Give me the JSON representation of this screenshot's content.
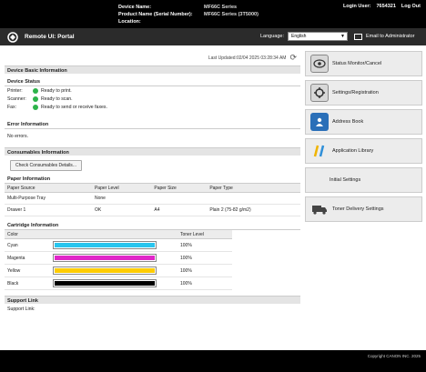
{
  "topbar": {
    "device_name_label": "Device Name:",
    "device_name_value": "MF66C Series",
    "product_name_label": "Product Name (Serial Number):",
    "product_name_value": "MF66C Series (3T5000)",
    "location_label": "Location:",
    "login_user_label": "Login User:",
    "login_user_value": "7654321",
    "logout_label": "Log Out"
  },
  "header": {
    "portal_title": "Remote UI: Portal",
    "language_label": "Language:",
    "language_value": "English",
    "email_admin_label": "Email to Administrator"
  },
  "main": {
    "last_updated": "Last Updated:02/04 2025 03:28:34 AM",
    "device_basic_title": "Device Basic Information",
    "device_status_title": "Device Status",
    "status_rows": [
      {
        "key": "Printer:",
        "value": "Ready to print."
      },
      {
        "key": "Scanner:",
        "value": "Ready to scan."
      },
      {
        "key": "Fax:",
        "value": "Ready to send or receive faxes."
      }
    ],
    "error_title": "Error Information",
    "error_text": "No errors.",
    "consumables_title": "Consumables Information",
    "check_consumables_label": "Check Consumables Details...",
    "paper_title": "Paper Information",
    "paper_headers": [
      "Paper Source",
      "Paper Level",
      "Paper Size",
      "Paper Type"
    ],
    "paper_rows": [
      [
        "Multi-Purpose Tray",
        "None",
        "",
        ""
      ],
      [
        "Drawer 1",
        "OK",
        "A4",
        "Plain 2 (75-82 g/m2)"
      ]
    ],
    "cartridge_title": "Cartridge Information",
    "cartridge_headers": [
      "Color",
      "",
      "Toner Level"
    ],
    "cartridges": [
      {
        "name": "Cyan",
        "level": "100%",
        "color": "#29c5ee"
      },
      {
        "name": "Magenta",
        "level": "100%",
        "color": "#e026c8"
      },
      {
        "name": "Yellow",
        "level": "100%",
        "color": "#ffcc00"
      },
      {
        "name": "Black",
        "level": "100%",
        "color": "#000000"
      }
    ],
    "support_title": "Support Link",
    "support_link_label": "Support Link:"
  },
  "sidebar": {
    "items": [
      {
        "label": "Status Monitor/Cancel",
        "icon": "status-monitor-icon"
      },
      {
        "label": "Settings/Registration",
        "icon": "settings-icon"
      },
      {
        "label": "Address Book",
        "icon": "address-book-icon"
      },
      {
        "label": "Application Library",
        "icon": "application-library-icon"
      },
      {
        "label": "Initial Settings",
        "icon": ""
      },
      {
        "label": "Toner Delivery Settings",
        "icon": "toner-delivery-icon"
      }
    ]
  },
  "footer": {
    "copyright": "Copyright CANON INC. 2025"
  }
}
